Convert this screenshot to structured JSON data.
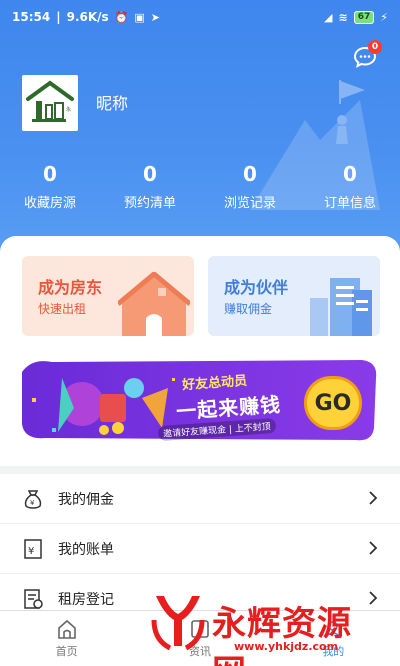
{
  "status_bar": {
    "time": "15:54",
    "speed": "9.6K/s",
    "battery": "67"
  },
  "profile": {
    "nickname": "昵称",
    "message_badge": "0"
  },
  "stats": [
    {
      "value": "0",
      "label": "收藏房源"
    },
    {
      "value": "0",
      "label": "预约清单"
    },
    {
      "value": "0",
      "label": "浏览记录"
    },
    {
      "value": "0",
      "label": "订单信息"
    }
  ],
  "promos": {
    "landlord": {
      "title": "成为房东",
      "subtitle": "快速出租"
    },
    "partner": {
      "title": "成为伙伴",
      "subtitle": "赚取佣金"
    }
  },
  "banner": {
    "title_small": "好友总动员",
    "title_large": "一起来赚钱",
    "subtitle": "邀请好友赚现金 | 上不封顶",
    "go_label": "GO"
  },
  "menu": [
    {
      "label": "我的佣金",
      "icon": "wallet-icon"
    },
    {
      "label": "我的账单",
      "icon": "bill-icon"
    },
    {
      "label": "租房登记",
      "icon": "register-icon"
    }
  ],
  "tabbar": [
    {
      "label": "首页",
      "icon": "home-icon"
    },
    {
      "label": "资讯",
      "icon": "news-icon"
    },
    {
      "label": "我的",
      "icon": "user-icon"
    }
  ],
  "watermark": {
    "text": "永辉资源网",
    "url": "www.yhkjdz.com"
  },
  "colors": {
    "header_blue": "#4a90f0",
    "landlord_accent": "#e8573a",
    "partner_accent": "#3f7fd8",
    "watermark_red": "#e61e1e"
  }
}
